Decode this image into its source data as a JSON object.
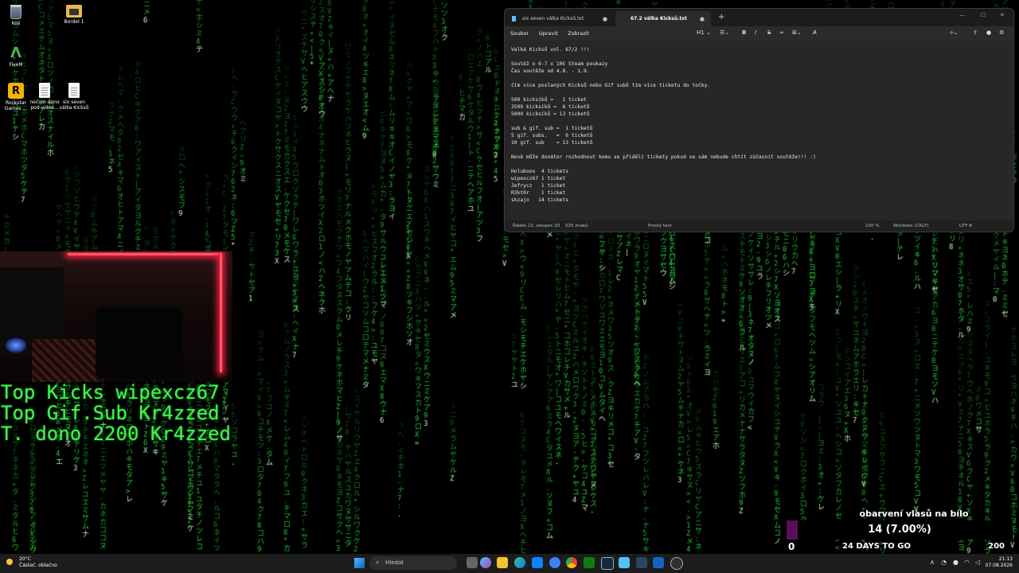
{
  "desktop": {
    "icons": [
      {
        "label": "Koš",
        "icon": "recycle-bin-icon"
      },
      {
        "label": "Bordel 1",
        "icon": "folder-icon"
      },
      {
        "label": "FiveM",
        "icon": "fivem-icon"
      },
      {
        "label": "Rockstar Games ...",
        "icon": "rockstar-icon"
      },
      {
        "label": "nečum dono pod videe...",
        "icon": "text-file-icon"
      },
      {
        "label": "six seven válka Kicksů",
        "icon": "text-file-icon"
      }
    ]
  },
  "notepad": {
    "tabs": [
      {
        "label": "six seven válka Kicksů.txt",
        "active": false
      },
      {
        "label": "67.2 válka Kicksů.txt",
        "active": true
      }
    ],
    "menu": [
      "Soubor",
      "Upravit",
      "Zobrazit"
    ],
    "heading_select": "H1",
    "lines": [
      "Valká Kicksů vol. 67/2 !!!",
      "",
      "Soutěž o 6-7 x 10€ Steam poukazy",
      "Čas soutěže od 4.8. - 1.9.",
      "",
      "čím více poslaných Kicksů nebo Gif subů tím více ticketu do točky.",
      "",
      "500 kicksíků =   1 ticket",
      "2500 kicksíků =  6 ticketů",
      "5000 kicksíků = 13 ticketů",
      "",
      "sub & gif. sub =  1 ticketů",
      "5 gif. subs.   =  6 ticketů",
      "10 gif. sub    = 13 ticketů",
      "",
      "Nově může donátor rozhodnout komu se přidělí tickety pokud se sám nebude chtít zúčasnit soutěže!!! :)",
      "",
      "Holuboos  4 tickets",
      "wipexcz67 1 ticket",
      "Jefrycz   1 ticket",
      "R3kt0r    1 ticket",
      "skzajo   14 tickets"
    ],
    "status": {
      "position": "Řádek 22, sloupec 20",
      "chars": "525 znaků",
      "format": "Prostý text",
      "zoom": "100 %",
      "line_ending": "Windows (CRLF)",
      "encoding": "UTF-8"
    }
  },
  "overlay": {
    "line1": "Top Kicks wipexcz67",
    "line2": "Top Gif.Sub Kr4zzed",
    "line3": "T. dono 2200 Kr4zzed"
  },
  "goal": {
    "title": "obarvení vlasů na bílo",
    "current": 14,
    "max_value": 200,
    "progress_text": "14 (7.00%)",
    "progress_fraction": 0.07,
    "min": "0",
    "max": "200",
    "days_left": "24 DAYS TO GO",
    "fill_color": "#5a0e5a"
  },
  "taskbar": {
    "weather_temp": "20°C",
    "weather_desc": "Částeč. oblačno",
    "search_label": "Hledat",
    "time": "21:13",
    "date": "07.08.2026"
  },
  "colors": {
    "matrix_green": "#49f04a",
    "accent_red": "#ff5a6a"
  }
}
